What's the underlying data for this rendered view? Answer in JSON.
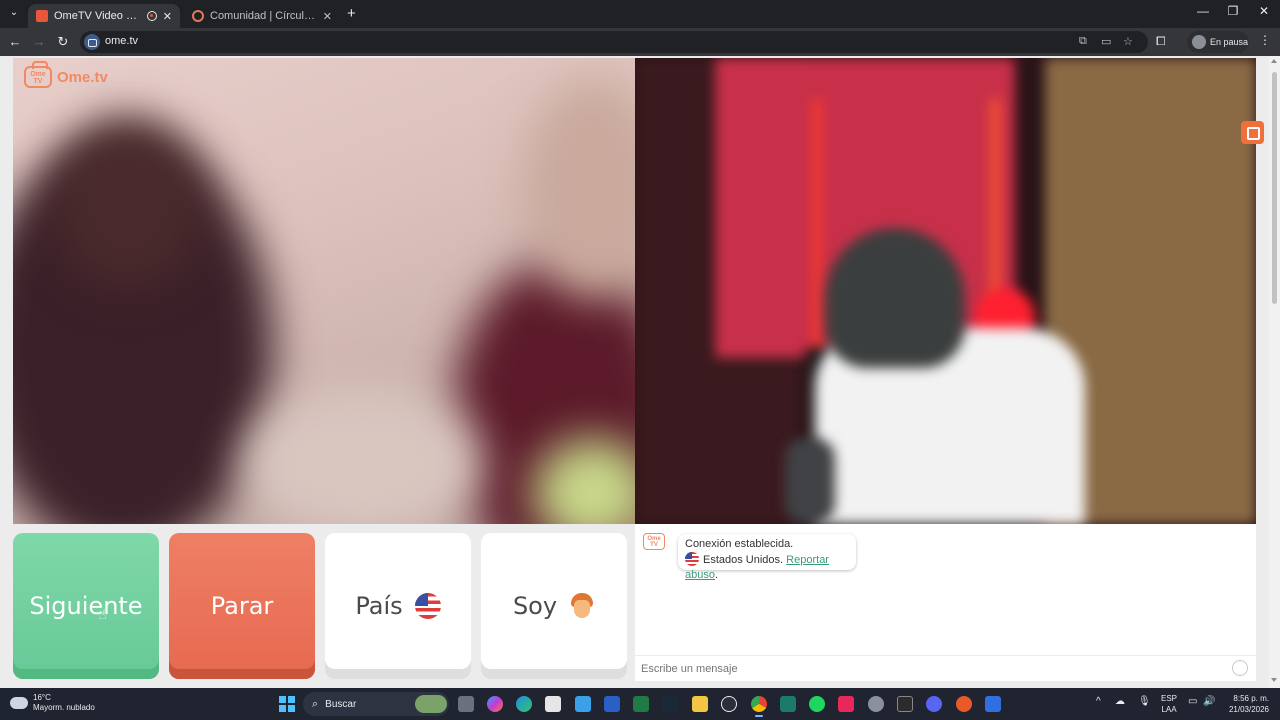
{
  "browser": {
    "tabs": [
      {
        "title": "OmeTV Video Chat — Ome",
        "active": true
      },
      {
        "title": "Comunidad | Círculo de Importan",
        "active": false
      }
    ],
    "url": "ome.tv",
    "profile_label": "En pausa"
  },
  "site": {
    "logo_text": "Ome.tv",
    "logo_badge": "Ome TV"
  },
  "controls": {
    "next_label": "Siguiente",
    "stop_label": "Parar",
    "country_label": "País",
    "gender_label": "Soy"
  },
  "chat": {
    "status_text": "Conexión establecida.",
    "country_text": "Estados Unidos.",
    "report_link": "Reportar abuso",
    "report_suffix": ".",
    "input_placeholder": "Escribe un mensaje"
  },
  "taskbar": {
    "temperature": "16°C",
    "weather": "Mayorm. nublado",
    "search_label": "Buscar",
    "lang_top": "ESP",
    "lang_bottom": "LAA",
    "time": "8:56 p. m.",
    "date": "21/03/2026"
  },
  "colors": {
    "next": "#6fd09d",
    "stop": "#ea7257",
    "accent": "#f08a63",
    "link": "#3a9a78"
  }
}
